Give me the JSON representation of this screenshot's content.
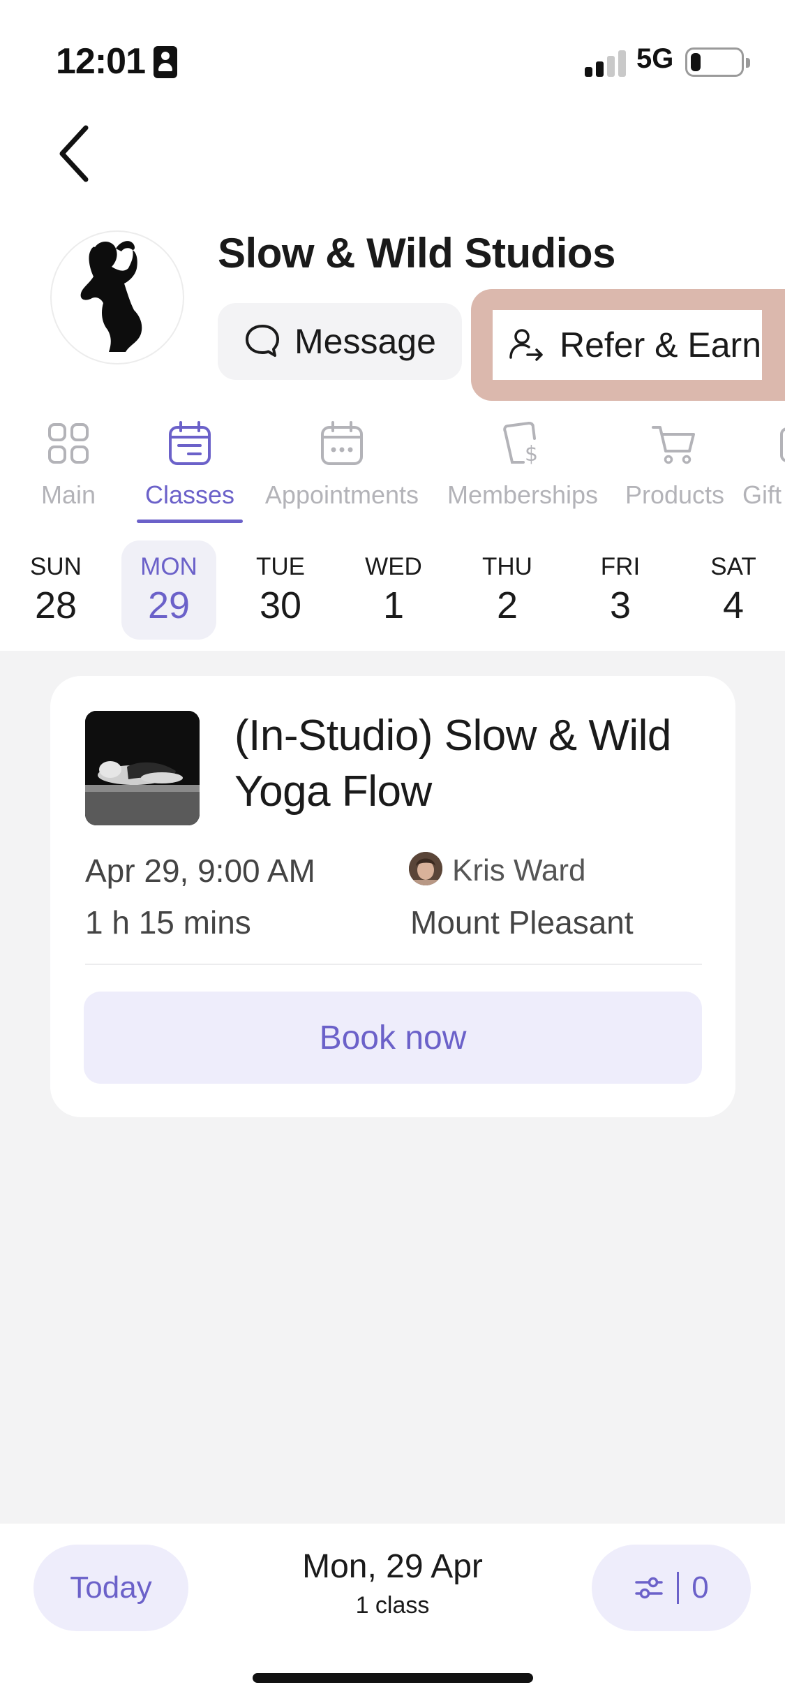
{
  "status_bar": {
    "time": "12:01",
    "network": "5G",
    "battery_level": 0.2,
    "signal_bars": 2
  },
  "header": {
    "studio_name": "Slow & Wild Studios",
    "message_label": "Message",
    "refer_label": "Refer & Earn"
  },
  "tabs": [
    {
      "label": "Main",
      "icon": "grid-icon",
      "active": false
    },
    {
      "label": "Classes",
      "icon": "calendar-icon",
      "active": true
    },
    {
      "label": "Appointments",
      "icon": "calendar-dots-icon",
      "active": false
    },
    {
      "label": "Memberships",
      "icon": "membership-card-icon",
      "active": false
    },
    {
      "label": "Products",
      "icon": "cart-icon",
      "active": false
    },
    {
      "label": "Gift",
      "icon": "gift-icon",
      "active": false
    }
  ],
  "week": [
    {
      "name": "SUN",
      "num": "28"
    },
    {
      "name": "MON",
      "num": "29"
    },
    {
      "name": "TUE",
      "num": "30"
    },
    {
      "name": "WED",
      "num": "1"
    },
    {
      "name": "THU",
      "num": "2"
    },
    {
      "name": "FRI",
      "num": "3"
    },
    {
      "name": "SAT",
      "num": "4"
    }
  ],
  "selected_day_index": 1,
  "class_card": {
    "title": "(In-Studio) Slow & Wild Yoga Flow",
    "datetime": "Apr 29, 9:00 AM",
    "duration": "1 h 15 mins",
    "instructor": "Kris Ward",
    "location": "Mount Pleasant",
    "book_label": "Book now"
  },
  "bottom_bar": {
    "today_label": "Today",
    "current_date": "Mon, 29 Apr",
    "class_count": "1 class",
    "filter_count": "0"
  },
  "colors": {
    "accent": "#6b61c9",
    "accent_soft": "#eeedfb",
    "highlight": "#dbb8ad",
    "inactive": "#b3b3b8"
  }
}
